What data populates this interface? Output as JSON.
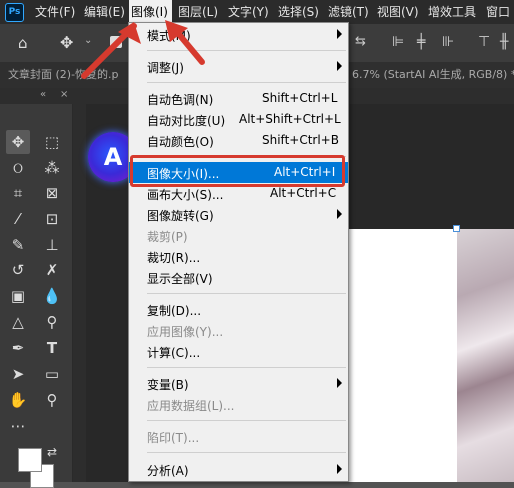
{
  "menubar": {
    "items": [
      {
        "label": "文件(F)",
        "active": false
      },
      {
        "label": "编辑(E)",
        "active": false
      },
      {
        "label": "图像(I)",
        "active": true
      },
      {
        "label": "图层(L)",
        "active": false
      },
      {
        "label": "文字(Y)",
        "active": false
      },
      {
        "label": "选择(S)",
        "active": false
      },
      {
        "label": "滤镜(T)",
        "active": false
      },
      {
        "label": "视图(V)",
        "active": false
      },
      {
        "label": "增效工具",
        "active": false
      },
      {
        "label": "窗口",
        "active": false
      }
    ]
  },
  "tabs": {
    "doc_left": "文章封面 (2)-恢复的.p",
    "doc_right": "6.7% (StartAI AI生成, RGB/8) *"
  },
  "logo_letter": "A",
  "image_menu": {
    "items": [
      {
        "label": "模式(M)",
        "shortcut": "",
        "submenu": true,
        "disabled": false
      },
      {
        "sep": true
      },
      {
        "label": "调整(J)",
        "shortcut": "",
        "submenu": true,
        "disabled": false
      },
      {
        "sep": true
      },
      {
        "label": "自动色调(N)",
        "shortcut": "Shift+Ctrl+L",
        "submenu": false,
        "disabled": false
      },
      {
        "label": "自动对比度(U)",
        "shortcut": "Alt+Shift+Ctrl+L",
        "submenu": false,
        "disabled": false
      },
      {
        "label": "自动颜色(O)",
        "shortcut": "Shift+Ctrl+B",
        "submenu": false,
        "disabled": false
      },
      {
        "sep": true
      },
      {
        "label": "图像大小(I)...",
        "shortcut": "Alt+Ctrl+I",
        "submenu": false,
        "disabled": false,
        "highlight": true
      },
      {
        "label": "画布大小(S)...",
        "shortcut": "Alt+Ctrl+C",
        "submenu": false,
        "disabled": false
      },
      {
        "label": "图像旋转(G)",
        "shortcut": "",
        "submenu": true,
        "disabled": false
      },
      {
        "label": "裁剪(P)",
        "shortcut": "",
        "submenu": false,
        "disabled": true
      },
      {
        "label": "裁切(R)...",
        "shortcut": "",
        "submenu": false,
        "disabled": false
      },
      {
        "label": "显示全部(V)",
        "shortcut": "",
        "submenu": false,
        "disabled": false
      },
      {
        "sep": true
      },
      {
        "label": "复制(D)...",
        "shortcut": "",
        "submenu": false,
        "disabled": false
      },
      {
        "label": "应用图像(Y)...",
        "shortcut": "",
        "submenu": false,
        "disabled": true
      },
      {
        "label": "计算(C)...",
        "shortcut": "",
        "submenu": false,
        "disabled": false
      },
      {
        "sep": true
      },
      {
        "label": "变量(B)",
        "shortcut": "",
        "submenu": true,
        "disabled": false
      },
      {
        "label": "应用数据组(L)...",
        "shortcut": "",
        "submenu": false,
        "disabled": true
      },
      {
        "sep": true
      },
      {
        "label": "陷印(T)...",
        "shortcut": "",
        "submenu": false,
        "disabled": true
      },
      {
        "sep": true
      },
      {
        "label": "分析(A)",
        "shortcut": "",
        "submenu": true,
        "disabled": false
      }
    ]
  },
  "colors": {
    "highlight": "#0078d7",
    "annotation_red": "#d63a2e",
    "foreground_swatch": "#ffffff",
    "background_swatch": "#ffffff"
  },
  "tool_icons": [
    "move-tool-icon",
    "marquee-tool-icon",
    "lasso-tool-icon",
    "magic-wand-icon",
    "crop-tool-icon",
    "frame-tool-icon",
    "eyedropper-icon",
    "spot-heal-icon",
    "brush-tool-icon",
    "stamp-tool-icon",
    "history-brush-icon",
    "eraser-tool-icon",
    "gradient-tool-icon",
    "blur-tool-icon",
    "dodge-tool-icon",
    "pen-tool-icon",
    "type-tool-icon",
    "path-select-icon",
    "rectangle-tool-icon",
    "hand-tool-icon",
    "zoom-tool-icon",
    "more-tools-icon",
    "swap-colors-icon"
  ]
}
